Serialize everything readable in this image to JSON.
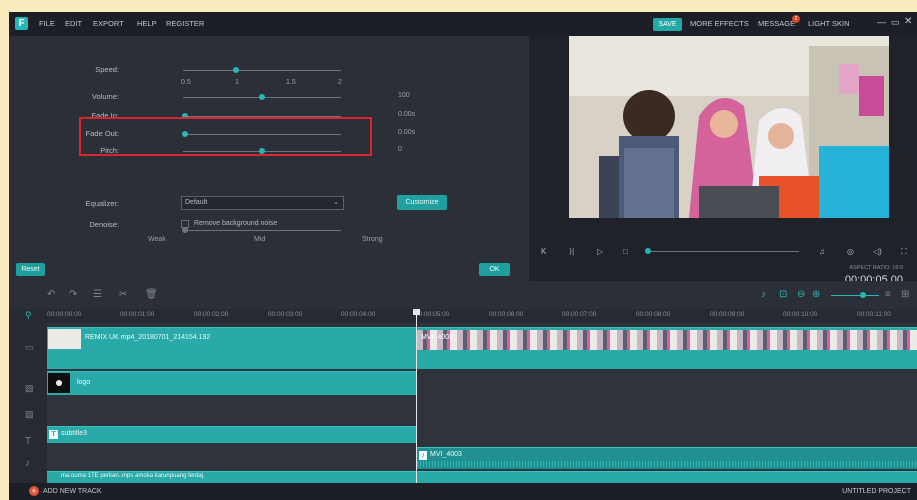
{
  "titlebar": {
    "menu": [
      "FILE",
      "EDIT",
      "EXPORT",
      "HELP",
      "REGISTER"
    ],
    "save": "SAVE",
    "more_effects": "MORE EFFECTS",
    "message": "MESSAGE",
    "message_badge": "2",
    "light_skin": "LIGHT SKIN"
  },
  "audio": {
    "speed": {
      "label": "Speed:",
      "ticks": [
        "0.5",
        "1",
        "1.5",
        "2"
      ],
      "value": 1
    },
    "volume": {
      "label": "Volume:",
      "value": "100",
      "fraction": 0.5
    },
    "fade_in": {
      "label": "Fade In:",
      "value": "0.00s",
      "fraction": 0
    },
    "fade_out": {
      "label": "Fade Out:",
      "value": "0.00s",
      "fraction": 0
    },
    "pitch": {
      "label": "Pitch:",
      "value": "0",
      "fraction": 0.5
    },
    "equalizer": {
      "label": "Equalizer:",
      "value": "Default"
    },
    "customize": "Customize",
    "denoise": {
      "label": "Denoise:",
      "checkbox": "Remove background noise"
    },
    "levels": [
      "Weak",
      "Mid",
      "Strong"
    ],
    "reset": "Reset",
    "ok": "OK"
  },
  "preview": {
    "aspect_ratio": "ASPECT RATIO: 16:9",
    "timecode": "00:00:05.00"
  },
  "timeline": {
    "ruler": [
      "00:00:00:00",
      "00:00:01:00",
      "00:00:02:00",
      "00:00:03:00",
      "00:00:04:00",
      "00:00:05:00",
      "00:00:06:00",
      "00:00:07:00",
      "00:00:08:00",
      "00:00:09:00",
      "00:00:10:00",
      "00:00:11:00"
    ],
    "clips": {
      "video1": "REMIX UK mp4_20180701_214154.192",
      "video2": "MVI_4003",
      "logo": "logo",
      "subtitle": "subtitle3",
      "audio": "MVI_4003",
      "music": "ma.ouma 1TE  perkan..mps  amoka  karunpuang terdaj"
    }
  },
  "bottom": {
    "add_track": "ADD NEW TRACK",
    "project": "UNTITLED PROJECT"
  },
  "colors": {
    "accent": "#27b6b6",
    "highlight": "#d9262d",
    "badge": "#e0442d"
  }
}
